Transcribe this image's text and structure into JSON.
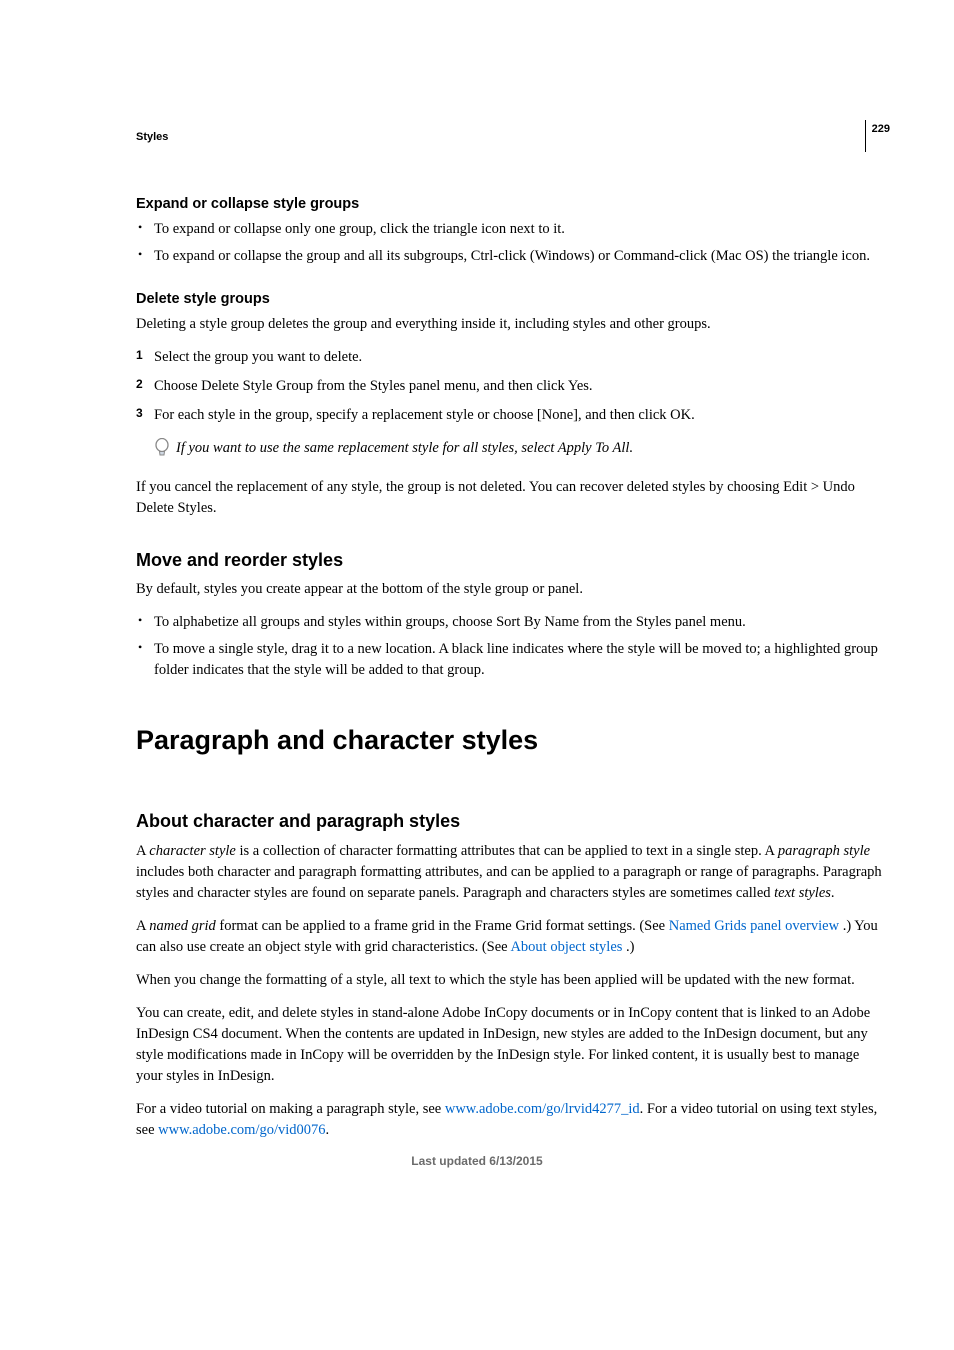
{
  "running_head": "Styles",
  "page_number": "229",
  "sec1": {
    "heading": "Expand or collapse style groups",
    "bullets": [
      "To expand or collapse only one group, click the triangle icon next to it.",
      "To expand or collapse the group and all its subgroups, Ctrl-click (Windows) or Command-click (Mac OS) the triangle icon."
    ]
  },
  "sec2": {
    "heading": "Delete style groups",
    "intro": "Deleting a style group deletes the group and everything inside it, including styles and other groups.",
    "steps": [
      "Select the group you want to delete.",
      "Choose Delete Style Group from the Styles panel menu, and then click Yes.",
      "For each style in the group, specify a replacement style or choose [None], and then click OK."
    ],
    "tip": "If you want to use the same replacement style for all styles, select Apply To All.",
    "after": "If you cancel the replacement of any style, the group is not deleted. You can recover deleted styles by choosing Edit > Undo Delete Styles."
  },
  "sec3": {
    "heading": "Move and reorder styles",
    "intro": "By default, styles you create appear at the bottom of the style group or panel.",
    "bullets": [
      "To alphabetize all groups and styles within groups, choose Sort By Name from the Styles panel menu.",
      "To move a single style, drag it to a new location. A black line indicates where the style will be moved to; a highlighted group folder indicates that the style will be added to that group."
    ]
  },
  "title": "Paragraph and character styles",
  "sec4": {
    "heading": "About character and paragraph styles",
    "p1": {
      "a": "A ",
      "i1": "character style",
      "b": " is a collection of character formatting attributes that can be applied to text in a single step. A ",
      "i2": "paragraph style",
      "c": " includes both character and paragraph formatting attributes, and can be applied to a paragraph or range of paragraphs. Paragraph styles and character styles are found on separate panels. Paragraph and characters styles are sometimes called ",
      "i3": "text styles",
      "d": "."
    },
    "p2": {
      "a": "A ",
      "i1": "named grid",
      "b": " format can be applied to a frame grid in the Frame Grid format settings. (See ",
      "link1": "Named Grids panel overview ",
      "c": ".) You can also use create an object style with grid characteristics. (See ",
      "link2": "About object styles ",
      "d": ".)"
    },
    "p3": "When you change the formatting of a style, all text to which the style has been applied will be updated with the new format.",
    "p4": "You can create, edit, and delete styles in stand-alone Adobe InCopy documents or in InCopy content that is linked to an Adobe InDesign CS4 document. When the contents are updated in InDesign, new styles are added to the InDesign document, but any style modifications made in InCopy will be overridden by the InDesign style. For linked content, it is usually best to manage your styles in InDesign.",
    "p5": {
      "a": "For a video tutorial on making a paragraph style, see ",
      "link1": "www.adobe.com/go/lrvid4277_id",
      "b": ". For a video tutorial on using text styles, see ",
      "link2": "www.adobe.com/go/vid0076",
      "c": "."
    }
  },
  "footer": "Last updated 6/13/2015"
}
